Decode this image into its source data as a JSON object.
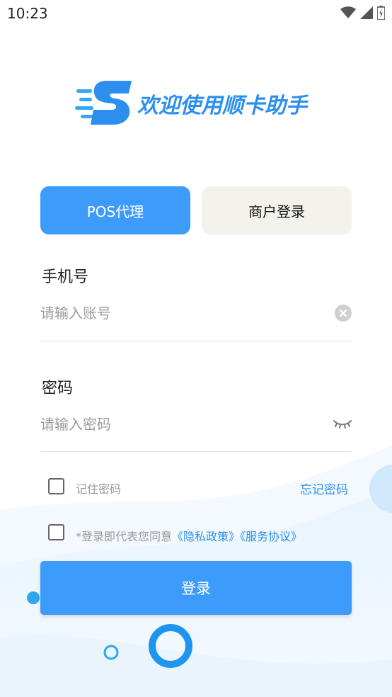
{
  "status_bar": {
    "time": "10:23"
  },
  "logo": {
    "text": "欢迎使用顺卡助手"
  },
  "tabs": [
    {
      "label": "POS代理",
      "active": true
    },
    {
      "label": "商户登录",
      "active": false
    }
  ],
  "phone": {
    "label": "手机号",
    "placeholder": "请输入账号",
    "value": ""
  },
  "password": {
    "label": "密码",
    "placeholder": "请输入密码",
    "value": ""
  },
  "remember": {
    "label": "记住密码",
    "checked": false
  },
  "forgot_label": "忘记密码",
  "agreement": {
    "prefix": "*登录即代表您同意",
    "privacy": "《隐私政策》",
    "service": "《服务协议》",
    "checked": false
  },
  "login_label": "登录",
  "colors": {
    "accent": "#3d9cfb",
    "link": "#2c8ff0",
    "tab_inactive_bg": "#f3f3ec"
  }
}
